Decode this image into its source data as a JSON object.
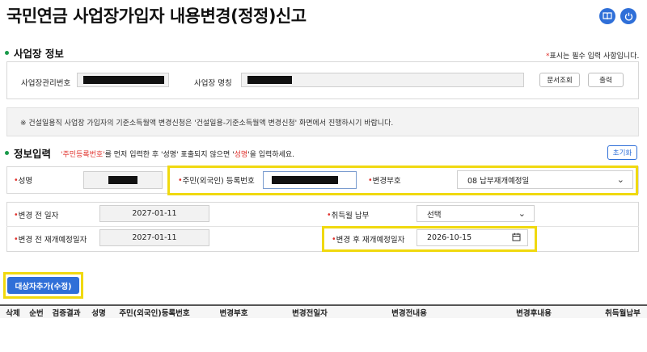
{
  "page": {
    "title": "국민연금 사업장가입자 내용변경(정정)신고",
    "top_icons": [
      "book-icon",
      "power-icon"
    ]
  },
  "workplace": {
    "heading": "사업장 정보",
    "required_mark": "*",
    "required_note": "표시는 필수 입력 사항입니다.",
    "mgmt_no_label": "사업장관리번호",
    "name_label": "사업장 명칭",
    "doc_lookup_label": "문서조회",
    "print_label": "출력"
  },
  "notice": {
    "text": "※ 건설일용직 사업장 가입자의 기준소득월액 변경신청은 '건설일용-기준소득월액 변경신청' 화면에서 진행하시기 바랍니다."
  },
  "info_input": {
    "heading": "정보입력",
    "hint_part1": "'주민등록번호'",
    "hint_part2": "를 먼저 입력한 후 '성명' 표출되지 않으면 '",
    "hint_part3": "성명",
    "hint_part4": "'을 입력하세요.",
    "reset_label": "초기화",
    "name_label": "성명",
    "rrn_label": "주민(외국인) 등록번호",
    "change_code_label": "변경부호",
    "change_code_value": "08 납부재개예정일",
    "before_date_label": "변경 전 일자",
    "before_date_value": "2027-01-11",
    "acq_month_label": "취득월 납부",
    "acq_month_value": "선택",
    "before_resume_label": "변경 전 재개예정일자",
    "before_resume_value": "2027-01-11",
    "after_resume_label": "변경 후 재개예정일자",
    "after_resume_value": "2026-10-15",
    "add_target_label": "대상자추가(수정)"
  },
  "table": {
    "columns": [
      "삭제",
      "순번",
      "검증결과",
      "성명",
      "주민(외국인)등록번호",
      "변경부호",
      "변경전일자",
      "변경전내용",
      "변경후내용",
      "취득월납부"
    ]
  },
  "colors": {
    "accent_blue": "#2f6fd8",
    "highlight_yellow": "#f0d90f",
    "required_red": "#e0322d",
    "bullet_green": "#1a9a4a"
  }
}
